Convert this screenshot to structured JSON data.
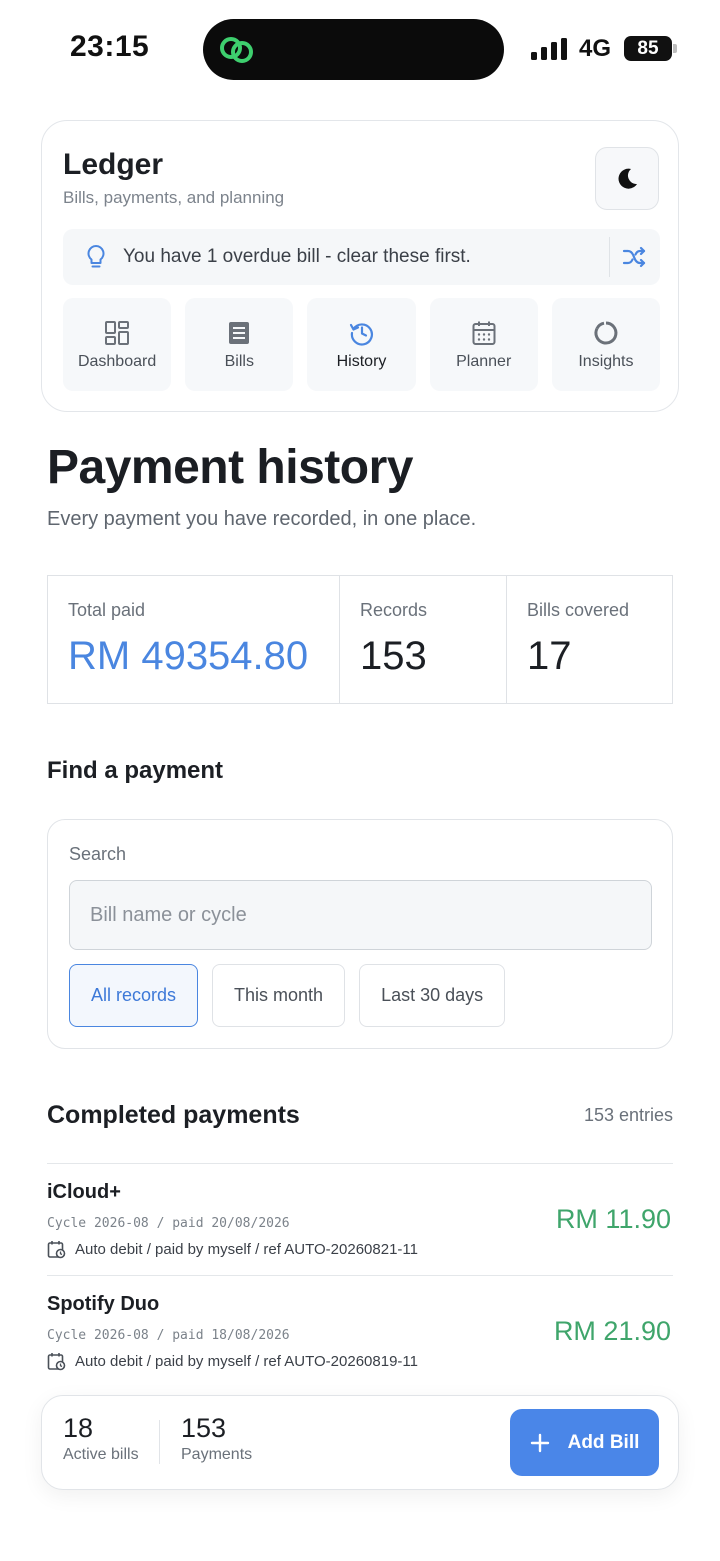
{
  "status_bar": {
    "time": "23:15",
    "network": "4G",
    "battery": "85"
  },
  "header": {
    "title": "Ledger",
    "subtitle": "Bills, payments, and planning",
    "theme_icon": "moon-icon",
    "tip": {
      "icon": "lightbulb-icon",
      "text": "You have 1 overdue bill - clear these first.",
      "action_icon": "shuffle-icon"
    }
  },
  "nav": {
    "items": [
      {
        "label": "Dashboard",
        "icon": "dashboard-icon"
      },
      {
        "label": "Bills",
        "icon": "receipt-icon"
      },
      {
        "label": "History",
        "icon": "history-icon",
        "active": true
      },
      {
        "label": "Planner",
        "icon": "calendar-icon"
      },
      {
        "label": "Insights",
        "icon": "donut-icon"
      }
    ]
  },
  "page": {
    "title": "Payment history",
    "subtitle": "Every payment you have recorded, in one place."
  },
  "stats": {
    "total_paid": {
      "label": "Total paid",
      "value": "RM 49354.80"
    },
    "records": {
      "label": "Records",
      "value": "153"
    },
    "bills_covered": {
      "label": "Bills covered",
      "value": "17"
    }
  },
  "find": {
    "title": "Find a payment",
    "search_label": "Search",
    "search_placeholder": "Bill name or cycle",
    "search_value": "",
    "filters": [
      {
        "label": "All records",
        "active": true
      },
      {
        "label": "This month"
      },
      {
        "label": "Last 30 days"
      }
    ]
  },
  "payments": {
    "title": "Completed payments",
    "count": "153 entries",
    "items": [
      {
        "name": "iCloud+",
        "cycle": "Cycle 2026-08 / paid 20/08/2026",
        "meta": "Auto debit / paid by myself / ref AUTO-20260821-11",
        "amount": "RM 11.90"
      },
      {
        "name": "Spotify Duo",
        "cycle": "Cycle 2026-08 / paid 18/08/2026",
        "meta": "Auto debit / paid by myself / ref AUTO-20260819-11",
        "amount": "RM 21.90"
      }
    ]
  },
  "bottom_bar": {
    "active_bills": {
      "value": "18",
      "label": "Active bills"
    },
    "payments": {
      "value": "153",
      "label": "Payments"
    },
    "add_button": "Add Bill"
  },
  "colors": {
    "accent": "#4a86e8",
    "positive": "#3fa56b",
    "island_icon": "#3ecf6e"
  }
}
